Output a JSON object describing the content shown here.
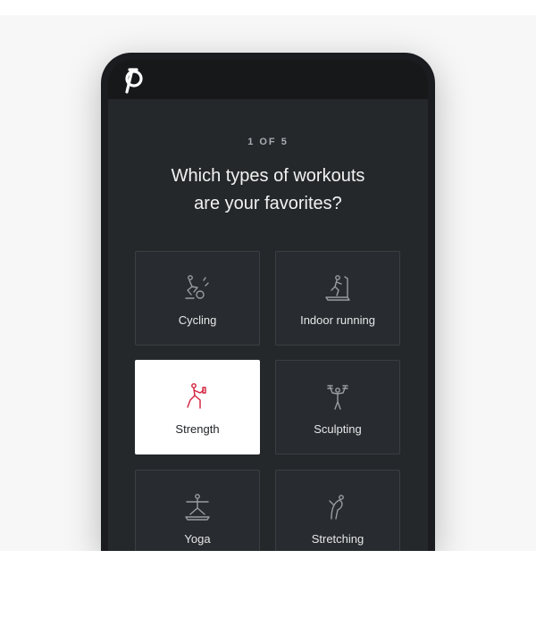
{
  "onboarding": {
    "step_label": "1 OF 5",
    "question_line1": "Which types of workouts",
    "question_line2": "are your favorites?"
  },
  "workouts": [
    {
      "label": "Cycling",
      "icon": "cycling-icon",
      "selected": false
    },
    {
      "label": "Indoor running",
      "icon": "treadmill-running-icon",
      "selected": false
    },
    {
      "label": "Strength",
      "icon": "strength-icon",
      "selected": true
    },
    {
      "label": "Sculpting",
      "icon": "dumbbell-press-icon",
      "selected": false
    },
    {
      "label": "Yoga",
      "icon": "yoga-pose-icon",
      "selected": false
    },
    {
      "label": "Stretching",
      "icon": "stretching-icon",
      "selected": false
    }
  ],
  "colors": {
    "brand_accent": "#d31f3c",
    "screen_bg": "#25282b",
    "tile_bg": "#282b2f",
    "selected_tile_bg": "#ffffff"
  },
  "brand": {
    "logo_icon": "peloton-logo-icon"
  }
}
